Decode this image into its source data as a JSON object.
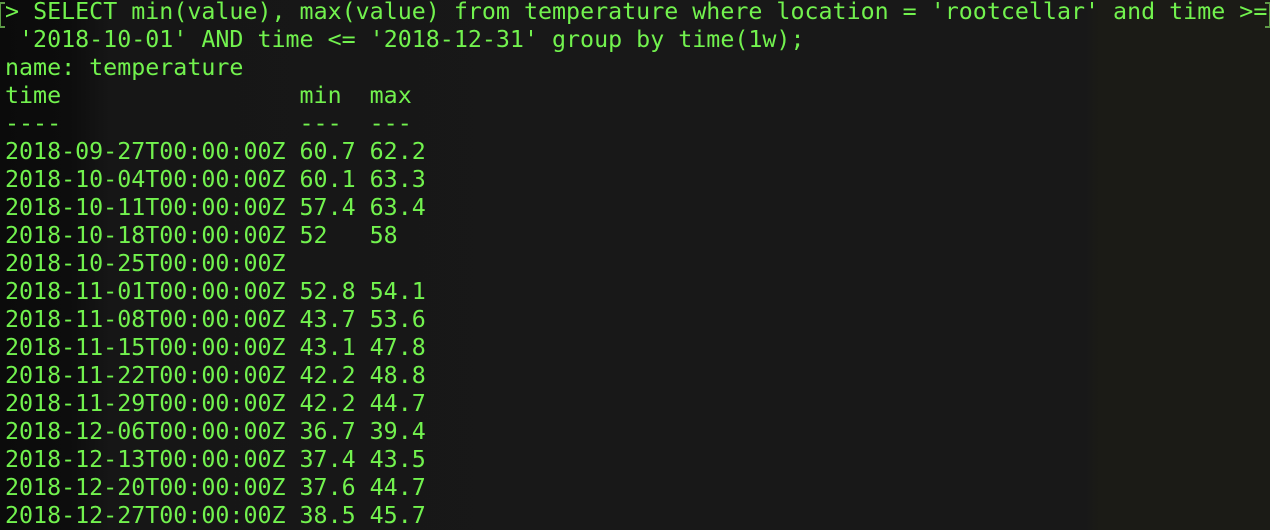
{
  "terminal": {
    "prompt": "> ",
    "command_line1": "SELECT min(value), max(value) from temperature where location = 'rootcellar' and time >=",
    "command_line2": " '2018-10-01' AND time <= '2018-12-31' group by time(1w);",
    "result_name": "name: temperature",
    "headers": {
      "time": "time",
      "min": "min",
      "max": "max"
    },
    "separators": {
      "time": "----",
      "min": "---",
      "max": "---"
    },
    "text_color": "#72f24e",
    "rows": [
      {
        "time": "2018-09-27T00:00:00Z",
        "min": "60.7",
        "max": "62.2"
      },
      {
        "time": "2018-10-04T00:00:00Z",
        "min": "60.1",
        "max": "63.3"
      },
      {
        "time": "2018-10-11T00:00:00Z",
        "min": "57.4",
        "max": "63.4"
      },
      {
        "time": "2018-10-18T00:00:00Z",
        "min": "52",
        "max": "58"
      },
      {
        "time": "2018-10-25T00:00:00Z",
        "min": "",
        "max": ""
      },
      {
        "time": "2018-11-01T00:00:00Z",
        "min": "52.8",
        "max": "54.1"
      },
      {
        "time": "2018-11-08T00:00:00Z",
        "min": "43.7",
        "max": "53.6"
      },
      {
        "time": "2018-11-15T00:00:00Z",
        "min": "43.1",
        "max": "47.8"
      },
      {
        "time": "2018-11-22T00:00:00Z",
        "min": "42.2",
        "max": "48.8"
      },
      {
        "time": "2018-11-29T00:00:00Z",
        "min": "42.2",
        "max": "44.7"
      },
      {
        "time": "2018-12-06T00:00:00Z",
        "min": "36.7",
        "max": "39.4"
      },
      {
        "time": "2018-12-13T00:00:00Z",
        "min": "37.4",
        "max": "43.5"
      },
      {
        "time": "2018-12-20T00:00:00Z",
        "min": "37.6",
        "max": "44.7"
      },
      {
        "time": "2018-12-27T00:00:00Z",
        "min": "38.5",
        "max": "45.7"
      }
    ]
  }
}
